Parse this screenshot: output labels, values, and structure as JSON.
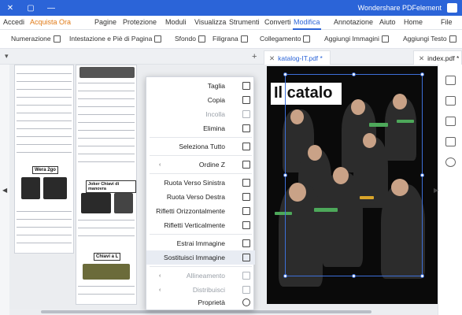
{
  "window": {
    "title": "Wondershare PDFelement",
    "controls": [
      "close-icon",
      "maximize-icon",
      "minimize-icon"
    ]
  },
  "menu": {
    "items": [
      "File",
      "Home",
      "Aiuto",
      "Annotazione",
      "Modifica",
      "Converti",
      "Strumenti",
      "Visualizza",
      "Moduli",
      "Protezione",
      "Pagine"
    ],
    "active": "Modifica",
    "store": "Acquista Ora",
    "login": "Accedi"
  },
  "toolbar": {
    "items": [
      "Aggiungi Testo",
      "Aggiungi Immagini",
      "Collegamento",
      "Filigrana",
      "Sfondo",
      "Intestazione e Piè di Pagina",
      "Numerazione"
    ]
  },
  "tabs": [
    {
      "label": "index.pdf *",
      "active": false
    },
    {
      "label": "katalog-IT.pdf *",
      "active": true
    }
  ],
  "catalog_page": {
    "heading": "Il catalo",
    "blocks": [
      "Wera 2go",
      "Joker Chiavi di manovra",
      "Chiavi a L"
    ]
  },
  "context_menu": {
    "items": [
      {
        "label": "Taglia",
        "icon": "scissors-icon",
        "disabled": false,
        "submenu": false
      },
      {
        "label": "Copia",
        "icon": "copy-icon",
        "disabled": false,
        "submenu": false
      },
      {
        "label": "Incolla",
        "icon": "paste-icon",
        "disabled": true,
        "submenu": false
      },
      {
        "label": "Elimina",
        "icon": "trash-icon",
        "disabled": false,
        "submenu": false
      },
      {
        "label": "Seleziona Tutto",
        "icon": "select-all-icon",
        "disabled": false,
        "submenu": false
      },
      {
        "label": "Ordine Z",
        "icon": "z-order-icon",
        "disabled": false,
        "submenu": true
      },
      {
        "label": "Ruota Verso Sinistra",
        "icon": "rotate-left-icon",
        "disabled": false,
        "submenu": false
      },
      {
        "label": "Ruota Verso Destra",
        "icon": "rotate-right-icon",
        "disabled": false,
        "submenu": false
      },
      {
        "label": "Rifletti Orizzontalmente",
        "icon": "flip-horizontal-icon",
        "disabled": false,
        "submenu": false
      },
      {
        "label": "Rifletti Verticalmente",
        "icon": "flip-vertical-icon",
        "disabled": false,
        "submenu": false
      },
      {
        "label": "Estrai Immagine",
        "icon": "extract-image-icon",
        "disabled": false,
        "submenu": false
      },
      {
        "label": "Sostituisci Immagine",
        "icon": "replace-image-icon",
        "disabled": false,
        "submenu": false,
        "highlighted": true
      },
      {
        "label": "Allineamento",
        "icon": "align-icon",
        "disabled": true,
        "submenu": true
      },
      {
        "label": "Distribuisci",
        "icon": "distribute-icon",
        "disabled": true,
        "submenu": true
      },
      {
        "label": "Proprietà",
        "icon": "properties-icon",
        "disabled": false,
        "submenu": false
      }
    ]
  },
  "right_panel": {
    "icons": [
      "thumbnails-icon",
      "bookmark-icon",
      "comment-icon",
      "attachment-icon",
      "search-icon"
    ]
  }
}
